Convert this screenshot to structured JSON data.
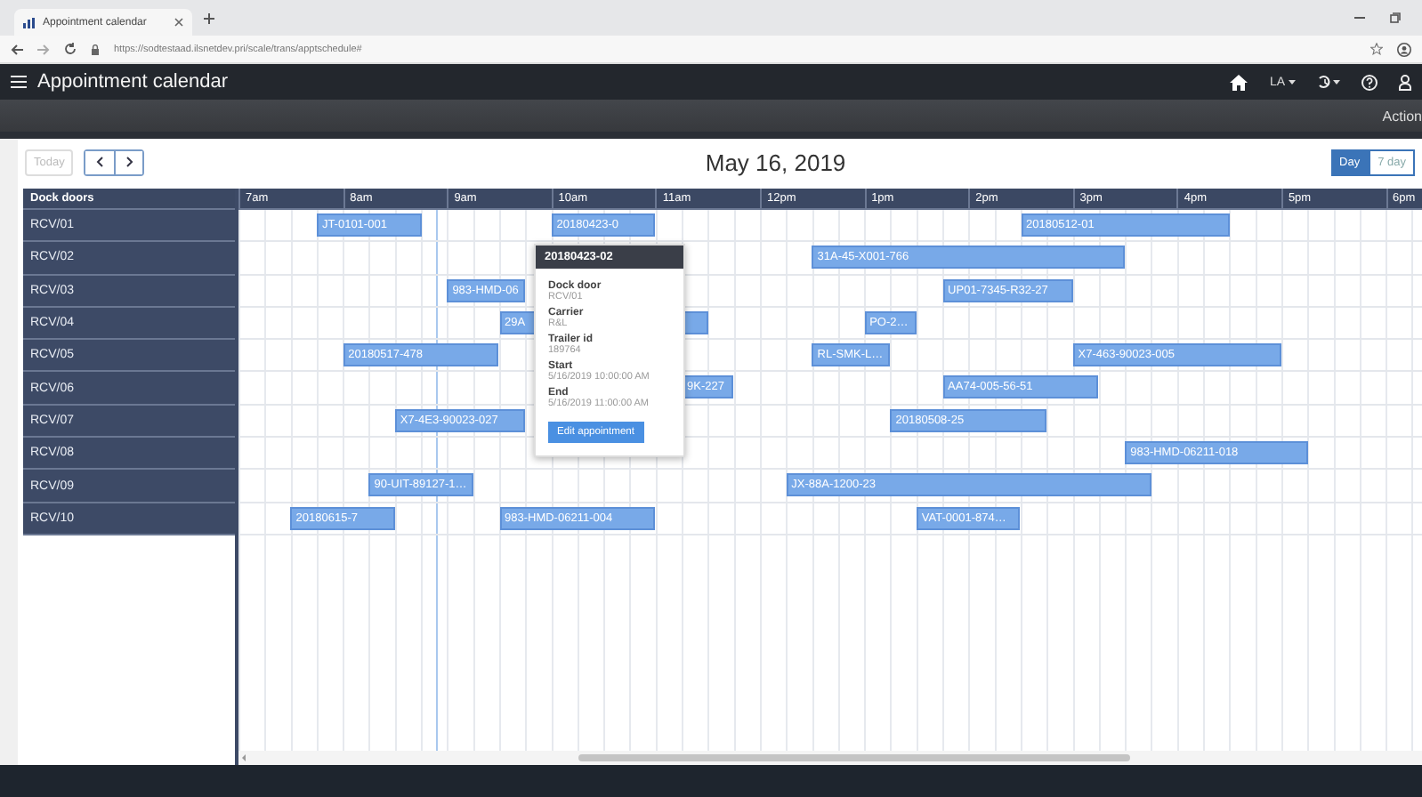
{
  "browser": {
    "tab_title": "Appointment calendar",
    "url": "https://sodtestaad.ilsnetdev.pri/scale/trans/apptschedule#"
  },
  "app": {
    "title": "Appointment calendar",
    "language": "LA",
    "toolbar_action": "Action"
  },
  "calendar": {
    "today": "Today",
    "date": "May 16, 2019",
    "views": [
      {
        "label": "Day",
        "selected": true
      },
      {
        "label": "7 day",
        "selected": false
      }
    ],
    "resource_header": "Dock doors",
    "hours": [
      "7am",
      "8am",
      "9am",
      "10am",
      "11am",
      "12pm",
      "1pm",
      "2pm",
      "3pm",
      "4pm",
      "5pm",
      "6pm"
    ],
    "rows": [
      {
        "name": "RCV/01",
        "appointments": [
          {
            "label": "JT-0101-001"
          },
          {
            "label": "20180423-0"
          },
          {
            "label": "20180512-01"
          }
        ]
      },
      {
        "name": "RCV/02",
        "appointments": [
          {
            "label": "31A-45-X001-766"
          }
        ]
      },
      {
        "name": "RCV/03",
        "appointments": [
          {
            "label": "983-HMD-06"
          },
          {
            "label": "UP01-7345-R32-27"
          }
        ]
      },
      {
        "name": "RCV/04",
        "appointments": [
          {
            "label": "29A"
          },
          {
            "label": "PO-2…"
          }
        ]
      },
      {
        "name": "RCV/05",
        "appointments": [
          {
            "label": "20180517-478"
          },
          {
            "label": "RL-SMK-L…"
          },
          {
            "label": "X7-463-90023-005"
          }
        ]
      },
      {
        "name": "RCV/06",
        "appointments": [
          {
            "label": "9K-227"
          },
          {
            "label": "AA74-005-56-51"
          }
        ]
      },
      {
        "name": "RCV/07",
        "appointments": [
          {
            "label": "X7-4E3-90023-027"
          },
          {
            "label": "20180508-25"
          }
        ]
      },
      {
        "name": "RCV/08",
        "appointments": [
          {
            "label": "983-HMD-06211-018"
          }
        ]
      },
      {
        "name": "RCV/09",
        "appointments": [
          {
            "label": "90-UIT-89127-1…"
          },
          {
            "label": "JX-88A-1200-23"
          }
        ]
      },
      {
        "name": "RCV/10",
        "appointments": [
          {
            "label": "20180615-7"
          },
          {
            "label": "983-HMD-06211-004"
          },
          {
            "label": "VAT-0001-874…"
          }
        ]
      }
    ],
    "popup": {
      "title": "20180423-02",
      "fields": [
        {
          "label": "Dock door",
          "value": "RCV/01"
        },
        {
          "label": "Carrier",
          "value": "R&L"
        },
        {
          "label": "Trailer id",
          "value": "189764"
        },
        {
          "label": "Start",
          "value": "5/16/2019 10:00:00 AM"
        },
        {
          "label": "End",
          "value": "5/16/2019 11:00:00 AM"
        }
      ],
      "button": "Edit appointment"
    }
  }
}
